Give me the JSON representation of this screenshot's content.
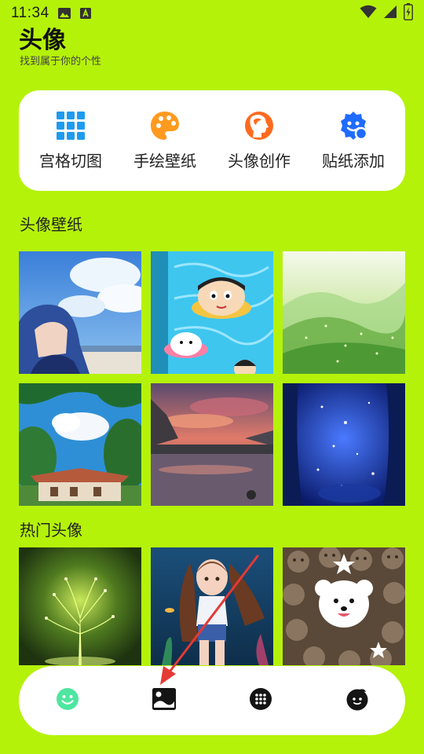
{
  "status_bar": {
    "time": "11:34"
  },
  "header": {
    "title": "头像",
    "subtitle": "找到属于你的个性"
  },
  "tools": [
    {
      "label": "宫格切图",
      "icon": "grid-icon",
      "color": "#1e9bf0"
    },
    {
      "label": "手绘壁纸",
      "icon": "palette-icon",
      "color": "#ff8f1f"
    },
    {
      "label": "头像创作",
      "icon": "face-profile-icon",
      "color": "#ff6a1f"
    },
    {
      "label": "贴纸添加",
      "icon": "sticker-icon",
      "color": "#1f6bff"
    }
  ],
  "sections": {
    "wallpapers": {
      "title": "头像壁纸"
    },
    "popular": {
      "title": "热门头像"
    }
  },
  "bottom_nav": [
    {
      "icon": "smile-icon",
      "selected": true
    },
    {
      "icon": "image-icon",
      "selected": false
    },
    {
      "icon": "apps-icon",
      "selected": false
    },
    {
      "icon": "profile-icon",
      "selected": false
    }
  ],
  "colors": {
    "background": "#b5f20a",
    "card": "#ffffff",
    "annotation_arrow": "#e53935"
  }
}
